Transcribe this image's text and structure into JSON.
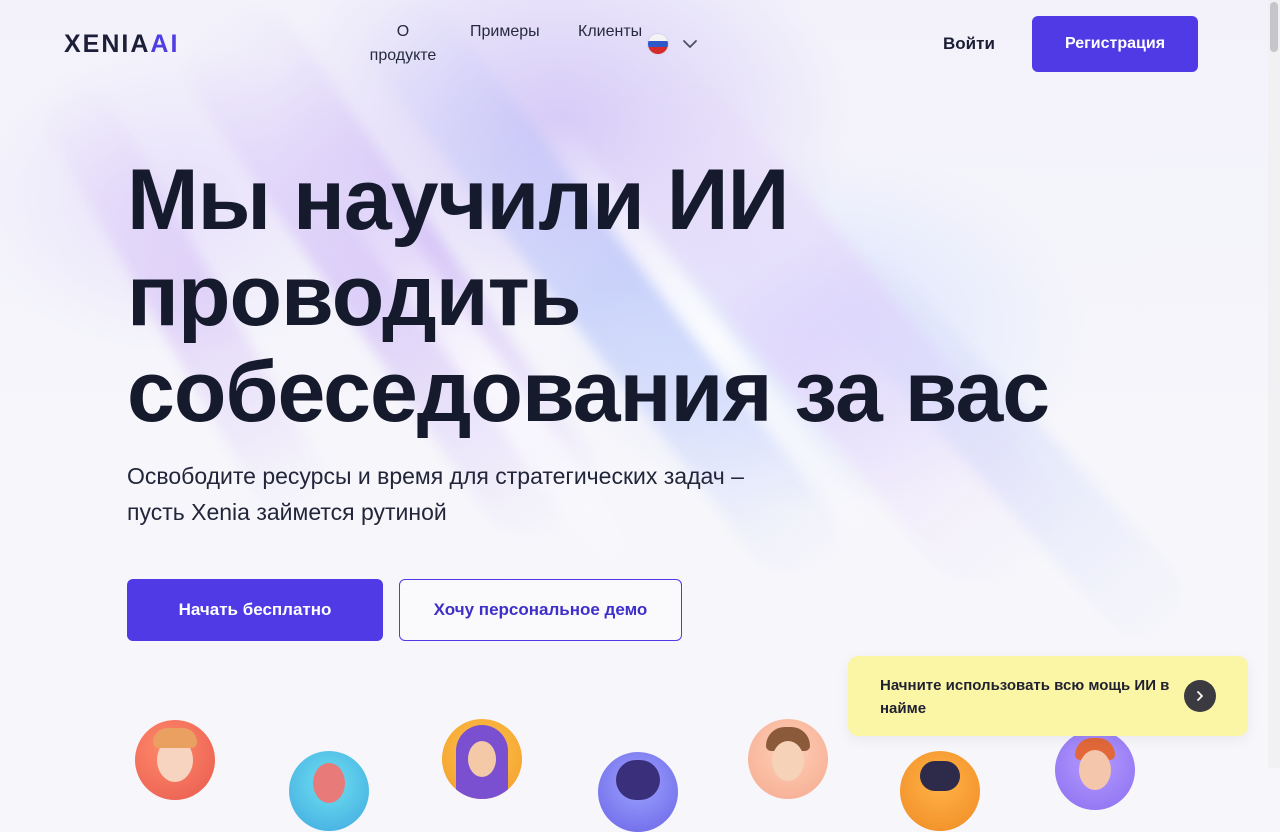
{
  "header": {
    "logo_main": "XENIA",
    "logo_accent": "AI",
    "nav": [
      {
        "label": "О продукте"
      },
      {
        "label": "Примеры"
      },
      {
        "label": "Клиенты"
      }
    ],
    "language_icon": "russia-flag-icon",
    "login_label": "Войти",
    "register_label": "Регистрация"
  },
  "hero": {
    "title": "Мы научили ИИ проводить собеседования за вас",
    "subtitle": "Освободите ресурсы и время для стратегических задач – пусть Xenia займется рутиной",
    "primary_cta": "Начать бесплатно",
    "secondary_cta": "Хочу персональное демо"
  },
  "promo": {
    "text": "Начните использовать всю мощь ИИ в найме",
    "icon": "chevron-right-icon"
  },
  "colors": {
    "accent": "#4f3ae6",
    "text_dark": "#161a2d",
    "promo_bg": "#fbf5a6"
  }
}
